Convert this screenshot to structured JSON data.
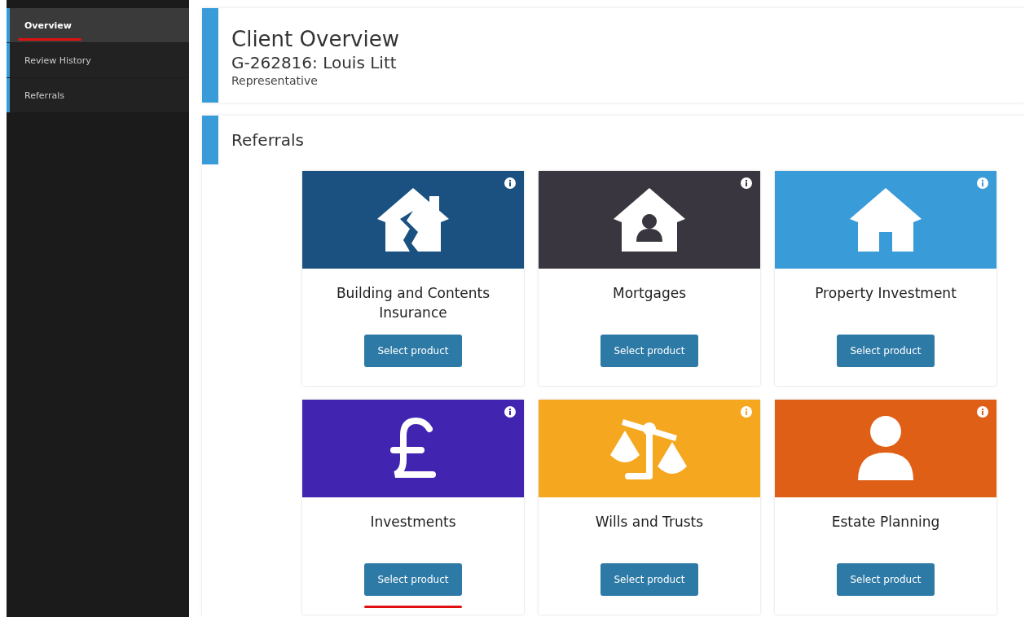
{
  "sidebar": {
    "items": [
      {
        "label": "Overview",
        "selected": true,
        "underlined": true
      },
      {
        "label": "Review History",
        "selected": false,
        "underlined": false
      },
      {
        "label": "Referrals",
        "selected": false,
        "underlined": false
      }
    ]
  },
  "header": {
    "title": "Client Overview",
    "client": "G-262816: Louis Litt",
    "role": "Representative"
  },
  "referrals": {
    "title": "Referrals",
    "cards": [
      {
        "kind": "house-broken",
        "color": "#1a5180",
        "title": "Building and Contents Insurance",
        "button": "Select product",
        "underlined": false
      },
      {
        "kind": "house-person",
        "color": "#39363f",
        "title": "Mortgages",
        "button": "Select product",
        "underlined": false
      },
      {
        "kind": "house",
        "color": "#3a9bd9",
        "title": "Property Investment",
        "button": "Select product",
        "underlined": false
      },
      {
        "kind": "pound",
        "color": "#4125b0",
        "title": "Investments",
        "button": "Select product",
        "underlined": true
      },
      {
        "kind": "scales",
        "color": "#f5a81f",
        "title": "Wills and Trusts",
        "button": "Select product",
        "underlined": false
      },
      {
        "kind": "person",
        "color": "#e05f16",
        "title": "Estate Planning",
        "button": "Select product",
        "underlined": false
      }
    ]
  }
}
